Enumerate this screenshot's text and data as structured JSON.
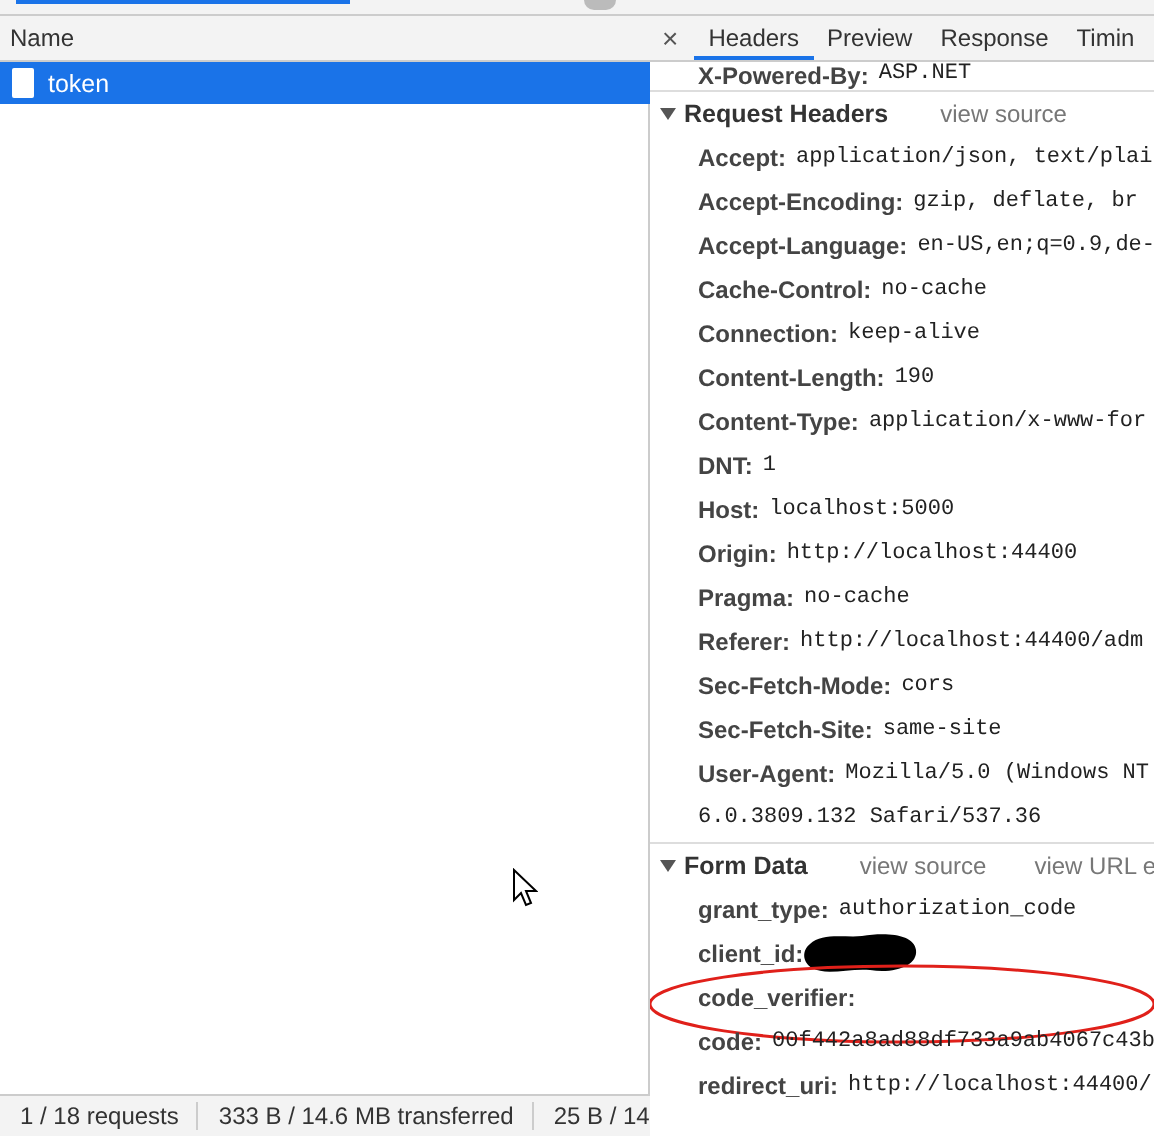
{
  "requests": {
    "column": "Name",
    "rows": [
      {
        "name": "token",
        "selected": true
      }
    ]
  },
  "status_bar": [
    "1 / 18 requests",
    "333 B / 14.6 MB transferred",
    "25 B / 14"
  ],
  "detail": {
    "close": "×",
    "tabs": [
      {
        "label": "Headers",
        "selected": true
      },
      {
        "label": "Preview",
        "selected": false
      },
      {
        "label": "Response",
        "selected": false
      },
      {
        "label": "Timin",
        "selected": false
      }
    ],
    "partial_header": {
      "name": "X-Powered-By:",
      "value": "ASP.NET"
    },
    "sections": [
      {
        "title": "Request Headers",
        "expanded": true,
        "links": [
          "view source"
        ],
        "rows": [
          {
            "name": "Accept:",
            "value": "application/json, text/plai"
          },
          {
            "name": "Accept-Encoding:",
            "value": "gzip, deflate, br"
          },
          {
            "name": "Accept-Language:",
            "value": "en-US,en;q=0.9,de-"
          },
          {
            "name": "Cache-Control:",
            "value": "no-cache"
          },
          {
            "name": "Connection:",
            "value": "keep-alive"
          },
          {
            "name": "Content-Length:",
            "value": "190"
          },
          {
            "name": "Content-Type:",
            "value": "application/x-www-for"
          },
          {
            "name": "DNT:",
            "value": "1"
          },
          {
            "name": "Host:",
            "value": "localhost:5000"
          },
          {
            "name": "Origin:",
            "value": "http://localhost:44400"
          },
          {
            "name": "Pragma:",
            "value": "no-cache"
          },
          {
            "name": "Referer:",
            "value": "http://localhost:44400/adm"
          },
          {
            "name": "Sec-Fetch-Mode:",
            "value": "cors"
          },
          {
            "name": "Sec-Fetch-Site:",
            "value": "same-site"
          },
          {
            "name": "User-Agent:",
            "value": "Mozilla/5.0 (Windows NT",
            "continuation": "6.0.3809.132 Safari/537.36"
          }
        ]
      },
      {
        "title": "Form Data",
        "expanded": true,
        "links": [
          "view source",
          "view URL e"
        ],
        "rows": [
          {
            "name": "grant_type:",
            "value": "authorization_code"
          },
          {
            "name": "client_id:",
            "redacted": true
          },
          {
            "name": "code_verifier:",
            "circled": true
          },
          {
            "name": "code:",
            "value": "00f442a8ad88df733a9ab4067c43b"
          },
          {
            "name": "redirect_uri:",
            "value": "http://localhost:44400/"
          }
        ]
      }
    ]
  }
}
